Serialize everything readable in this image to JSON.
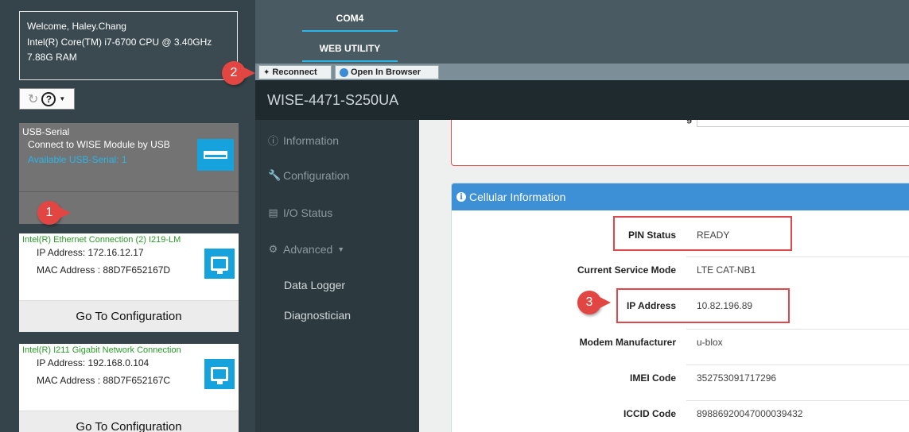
{
  "system": {
    "welcome": "Welcome, Haley.Chang",
    "cpu": "Intel(R) Core(TM) i7-6700 CPU @ 3.40GHz",
    "ram": "7.88G RAM"
  },
  "tools": {
    "refresh_icon": "refresh-icon",
    "help_icon": "?"
  },
  "usb": {
    "title": "USB-Serial",
    "subtitle": "Connect to WISE Module by USB",
    "available": "Available USB-Serial: 1"
  },
  "networks": [
    {
      "name": "Intel(R) Ethernet Connection (2) I219-LM",
      "ip": "IP Address: 172.16.12.17",
      "mac": "MAC Address : 88D7F652167D",
      "action": "Go To Configuration"
    },
    {
      "name": "Intel(R) I211 Gigabit Network Connection",
      "ip": "IP Address: 192.168.0.104",
      "mac": "MAC Address : 88D7F652167C",
      "action": "Go To Configuration"
    }
  ],
  "tabs": {
    "com4": "COM4",
    "web": "WEB UTILITY"
  },
  "toolbar": {
    "reconnect": "Reconnect",
    "open_browser": "Open In Browser"
  },
  "device": {
    "name": "WISE-4471-S250UA"
  },
  "nav": {
    "information": "Information",
    "configuration": "Configuration",
    "io_status": "I/O Status",
    "advanced": "Advanced",
    "data_logger": "Data Logger",
    "diagnostician": "Diagnostician"
  },
  "cellular": {
    "title": "Cellular Information",
    "rows": [
      {
        "label": "PIN Status",
        "value": "READY"
      },
      {
        "label": "Current Service Mode",
        "value": "LTE CAT-NB1"
      },
      {
        "label": "IP Address",
        "value": "10.82.196.89"
      },
      {
        "label": "Modem Manufacturer",
        "value": "u-blox"
      },
      {
        "label": "IMEI Code",
        "value": "352753091717296"
      },
      {
        "label": "ICCID Code",
        "value": "89886920047000039432"
      }
    ]
  },
  "badges": {
    "one": "1",
    "two": "2",
    "three": "3"
  },
  "colors": {
    "accent": "#29b6e8",
    "panel_header": "#3d8fd6",
    "highlight": "#e0464a",
    "green_text": "#2a9a2a"
  }
}
